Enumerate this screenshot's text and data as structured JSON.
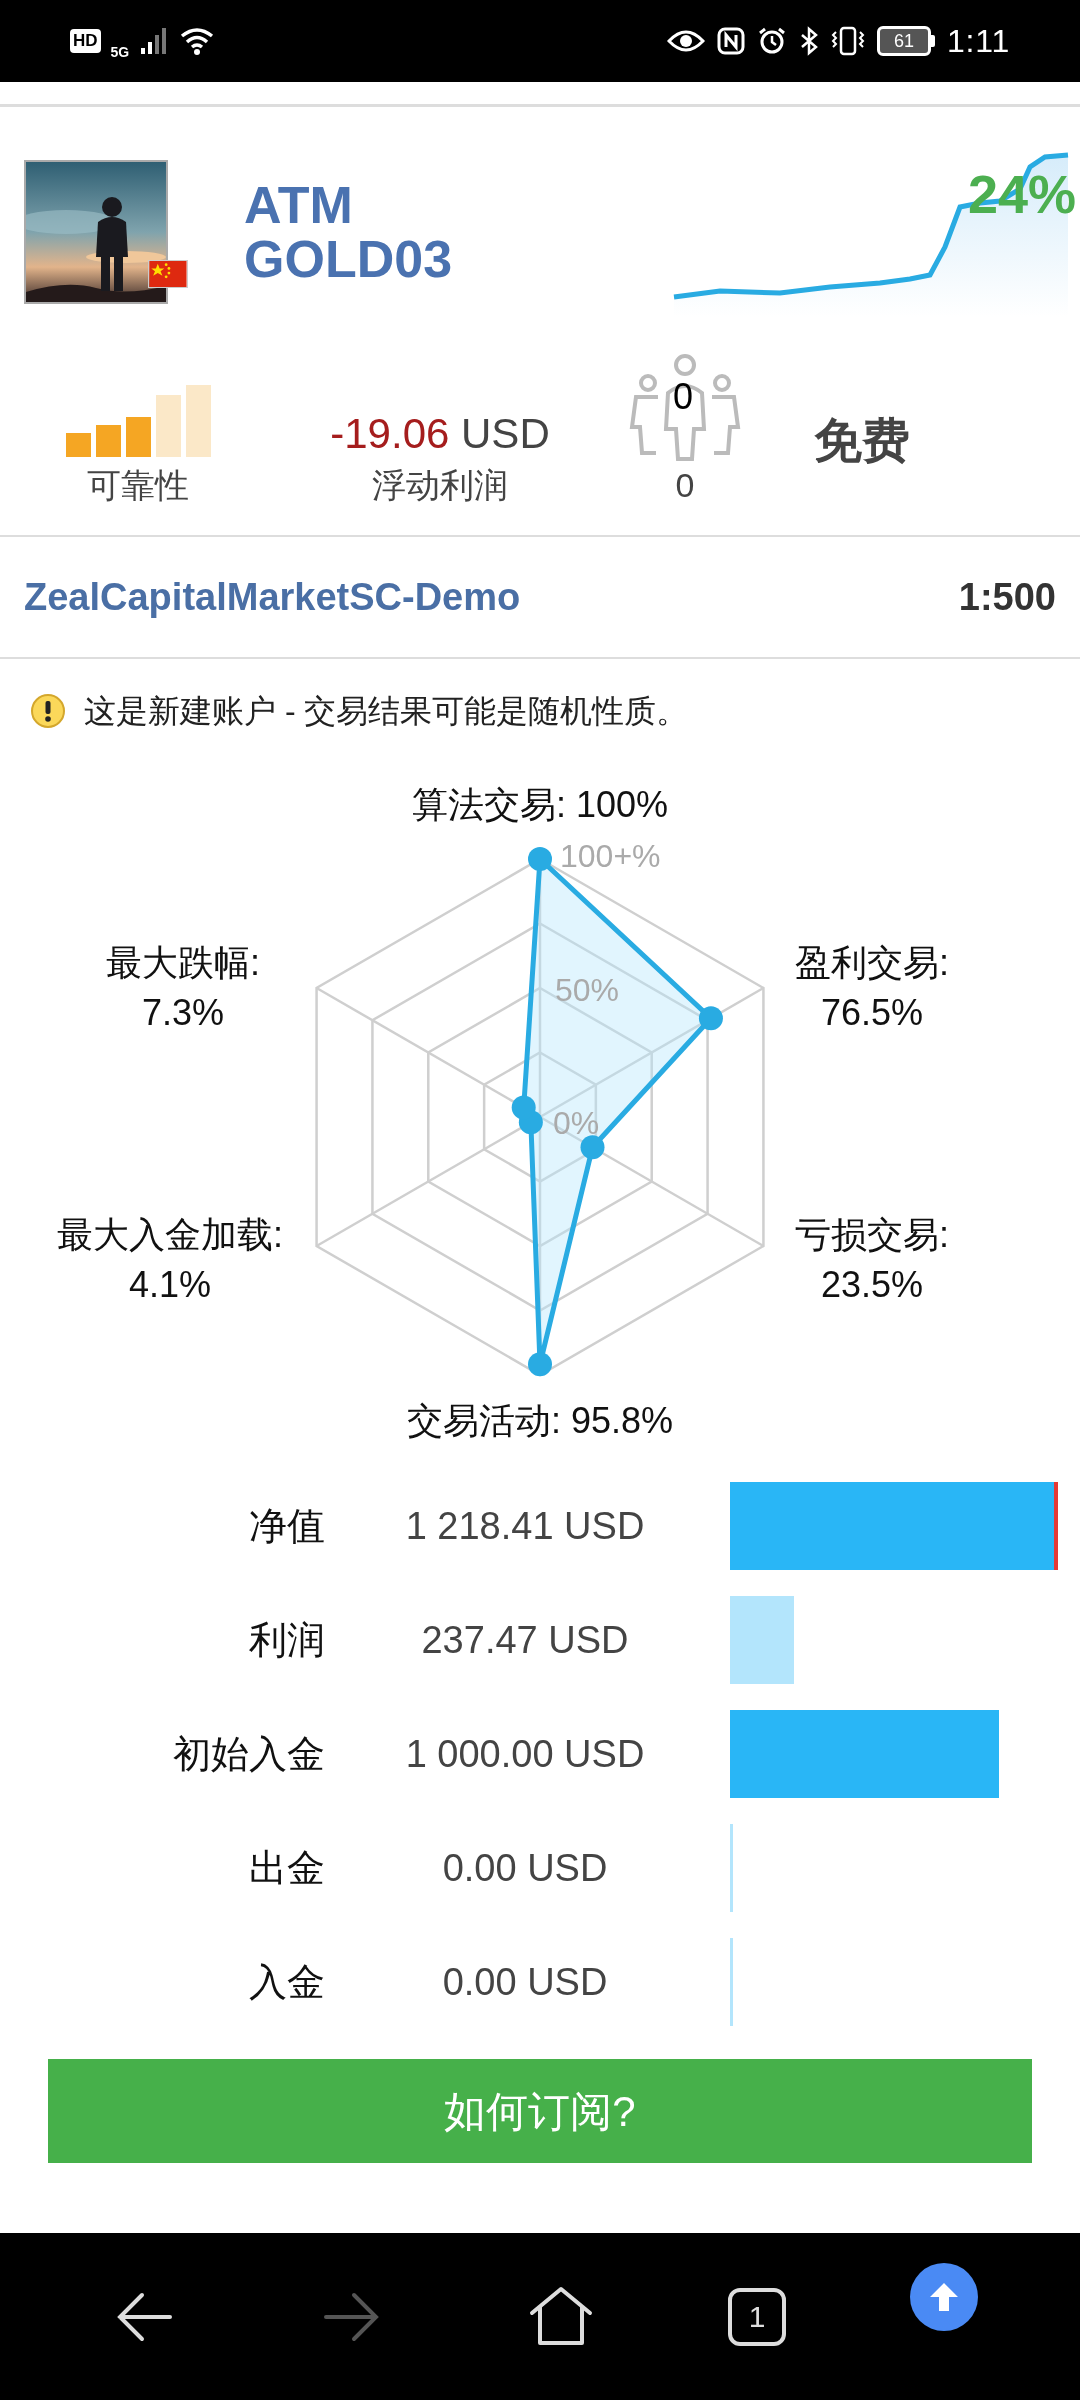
{
  "status_bar": {
    "network_badge": "HD",
    "network_type": "5G",
    "battery": "61",
    "time": "1:11"
  },
  "header": {
    "title_lines": [
      "ATM",
      "GOLD03"
    ],
    "growth": "24%"
  },
  "stats": {
    "reliability": {
      "label": "可靠性",
      "level": 0.6
    },
    "floating_profit": {
      "value": "-19.06",
      "currency": "USD",
      "label": "浮动利润"
    },
    "subscribers": {
      "icon_count": "0",
      "count": "0"
    },
    "price": "免费"
  },
  "account": {
    "server": "ZealCapitalMarketSC-Demo",
    "leverage": "1:500"
  },
  "warning": "这是新建账户 - 交易结果可能是随机性质。",
  "radar": {
    "scale_labels": [
      "100+%",
      "50%",
      "0%"
    ],
    "axes": [
      {
        "label": "算法交易:",
        "value": "100%",
        "kind": "top"
      },
      {
        "label": "最大跌幅:",
        "value": "7.3%",
        "kind": "upperleft"
      },
      {
        "label": "盈利交易:",
        "value": "76.5%",
        "kind": "upperright"
      },
      {
        "label": "最大入金加载:",
        "value": "4.1%",
        "kind": "lowerleft"
      },
      {
        "label": "亏损交易:",
        "value": "23.5%",
        "kind": "lowerright"
      },
      {
        "label": "交易活动:",
        "value": "95.8%",
        "kind": "bottom"
      }
    ]
  },
  "balances": [
    {
      "label": "净值",
      "value": "1 218.41 USD",
      "color": "#29b6f6",
      "overflow": true
    },
    {
      "label": "利润",
      "value": "237.47 USD",
      "color": "#b3e5fc",
      "overflow": false
    },
    {
      "label": "初始入金",
      "value": "1 000.00 USD",
      "color": "#29b6f6",
      "overflow": false
    },
    {
      "label": "出金",
      "value": "0.00 USD",
      "color": "#b3e5fc",
      "overflow": false
    },
    {
      "label": "入金",
      "value": "0.00 USD",
      "color": "#b3e5fc",
      "overflow": false
    }
  ],
  "subscribe_button": "如何订阅?",
  "nav_bar": {
    "back_enabled": true,
    "forward_enabled": false,
    "tab_count": "1"
  }
}
